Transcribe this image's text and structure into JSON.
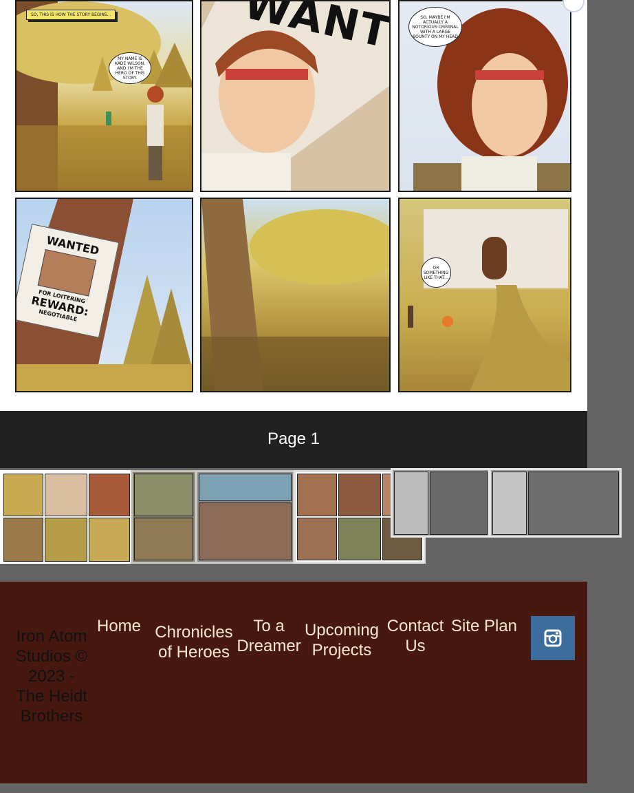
{
  "comic": {
    "caption": "SO, THIS IS HOW THE STORY BEGINS...",
    "bubble_intro": "MY NAME IS KADE WILSON, AND I'M THE HERO OF THIS STORY.",
    "poster_word_large": "WANTE",
    "bubble_criminal": "SO, MAYBE I'M ACTUALLY A NOTORIOUS CRIMINAL WITH A LARGE BOUNTY ON MY HEAD",
    "poster_title": "WANTED",
    "poster_for": "FOR LOITERING",
    "poster_reward": "REWARD:",
    "poster_negotiable": "NEGOTIABLE",
    "bubble_gate": "OR SOMETHING LIKE THAT..."
  },
  "page_label": "Page 1",
  "footer": {
    "copyright": "Iron Atom Studios © 2023 - The Heidt Brothers",
    "nav": {
      "home": "Home",
      "chronicles": "Chronicles of Heroes",
      "dreamer": "To a Dreamer",
      "upcoming": "Upcoming Projects",
      "contact": "Contact Us",
      "siteplan": "Site Plan"
    }
  },
  "icons": {
    "corner": "circle-icon",
    "instagram": "instagram-icon"
  },
  "colors": {
    "page_bar": "#212121",
    "footer": "#46180f",
    "nav_text": "#f6e7cf",
    "instagram": "#3d6d9c"
  }
}
